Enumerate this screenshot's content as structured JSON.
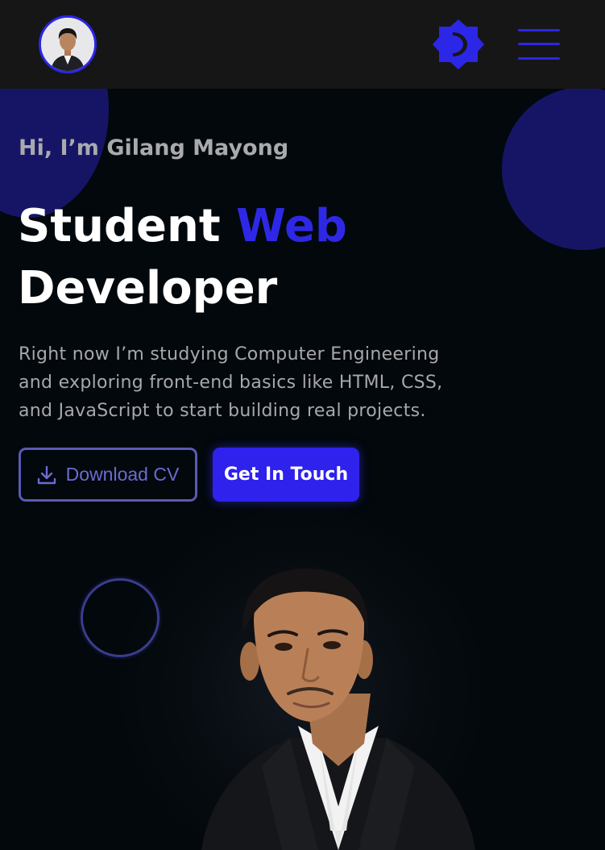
{
  "header": {
    "avatar_icon": "profile-photo",
    "theme_toggle_icon": "brightness-icon",
    "menu_icon": "hamburger-menu-icon"
  },
  "hero": {
    "greeting": "Hi, I’m Gilang Mayong",
    "headline_part1": "Student ",
    "headline_accent": "Web",
    "headline_part2": "Developer",
    "intro_line1": "Right now I’m studying Computer Engineering",
    "intro_line2": "and exploring front-end basics like HTML, CSS,",
    "intro_line3": "and JavaScript to start building real projects.",
    "download_label": "Download CV",
    "download_icon": "download-icon",
    "contact_label": "Get In Touch"
  },
  "colors": {
    "accent": "#2e28e6",
    "background": "#02080c",
    "topbar": "#161616",
    "blob": "#161565"
  }
}
